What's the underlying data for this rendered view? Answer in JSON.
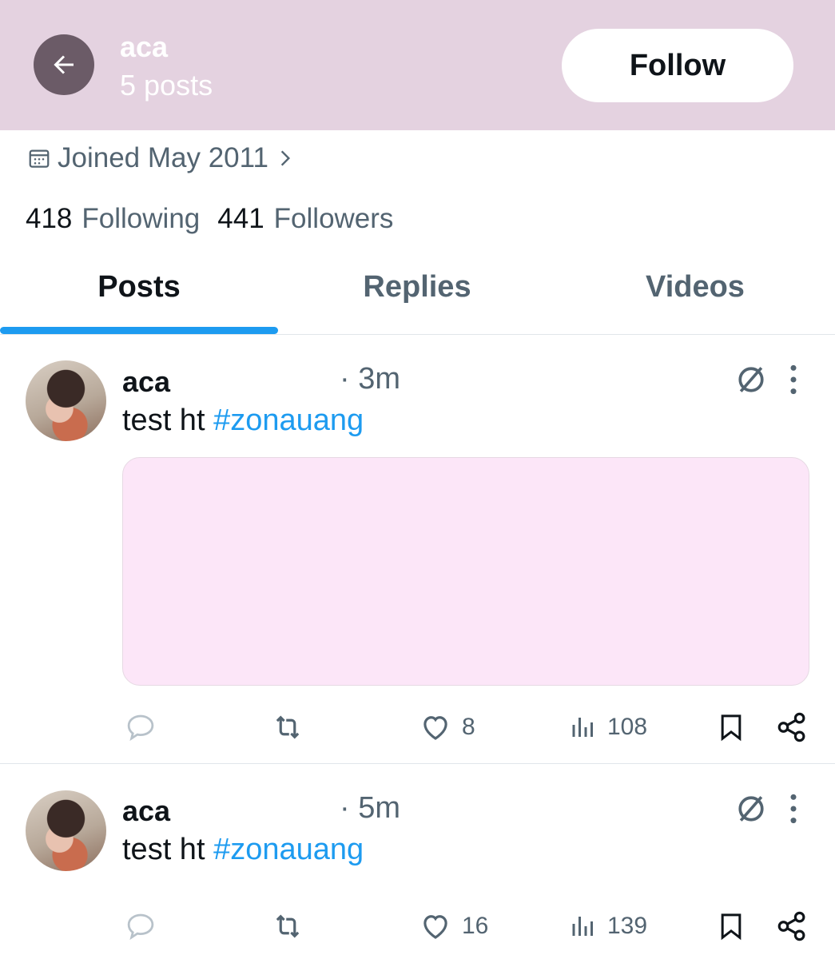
{
  "header": {
    "name": "aca",
    "post_count": "5 posts",
    "follow_label": "Follow",
    "background": "#e4d2e0"
  },
  "profile": {
    "joined": "Joined May 2011",
    "following_count": "418",
    "following_label": "Following",
    "followers_count": "441",
    "followers_label": "Followers"
  },
  "tabs": [
    {
      "label": "Posts",
      "active": true
    },
    {
      "label": "Replies",
      "active": false
    },
    {
      "label": "Videos",
      "active": false
    }
  ],
  "posts": [
    {
      "name": "aca",
      "time": "· 3m",
      "text": "test ht ",
      "hashtag": "#zonauang",
      "has_media": true,
      "likes": "8",
      "views": "108"
    },
    {
      "name": "aca",
      "time": "· 5m",
      "text": "test ht ",
      "hashtag": "#zonauang",
      "has_media": false,
      "likes": "16",
      "views": "139"
    }
  ],
  "colors": {
    "accent": "#1d9bf0",
    "muted": "#536471",
    "media_placeholder": "#fce6f8"
  }
}
